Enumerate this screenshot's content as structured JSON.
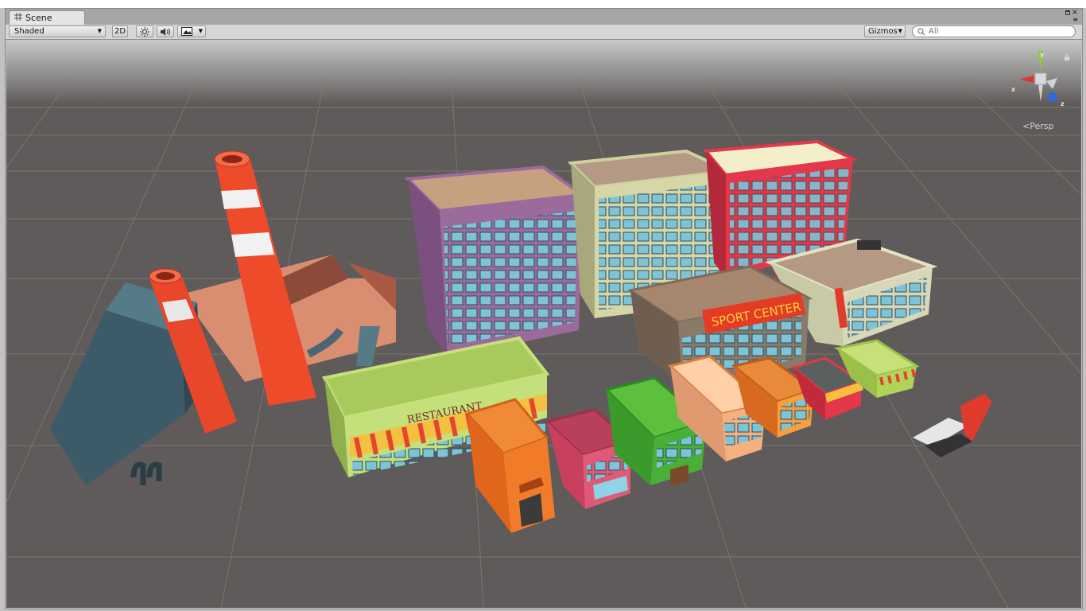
{
  "tab": {
    "icon": "grid-icon",
    "title": "Scene"
  },
  "toolbar": {
    "shading_mode": "Shaded",
    "mode_2d": "2D",
    "lighting_icon": "sun-icon",
    "audio_icon": "speaker-icon",
    "effects_icon": "image-icon",
    "gizmos_label": "Gizmos",
    "search_placeholder": "All"
  },
  "scene_gizmo": {
    "y_label": "y",
    "x_label": "x",
    "z_label": "z",
    "projection_label": "Persp",
    "colors": {
      "x": "#e0332b",
      "y": "#86d12b",
      "z": "#2f6bd8"
    }
  },
  "scene": {
    "signs": {
      "restaurant": "RESTAURANT",
      "sport_center": "SPORT CENTER"
    },
    "colors": {
      "grid_background": "#5e5b5a",
      "chimney": "#ee4b2b",
      "purple_building": "#9b6b9b",
      "cream_building": "#cfcf9f",
      "red_building": "#e2384a",
      "restaurant": "#b8d96b",
      "sport_center": "#8a7a6a"
    }
  }
}
